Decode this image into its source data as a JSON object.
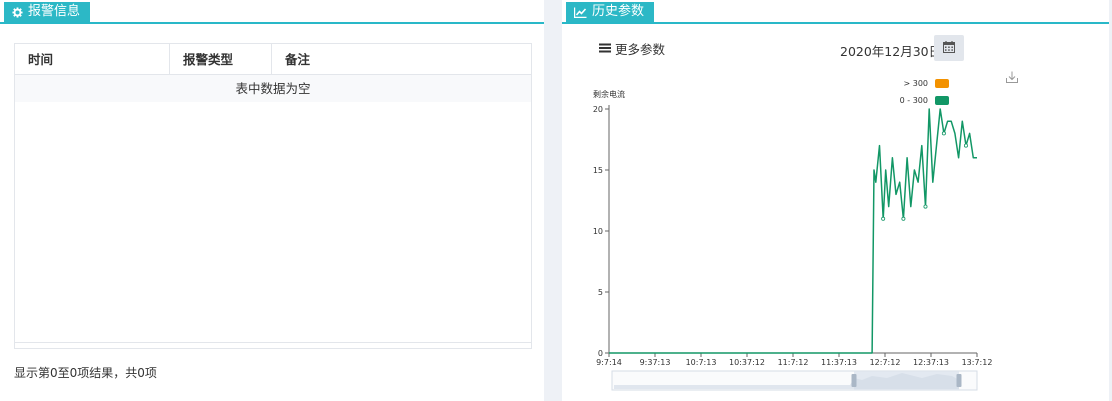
{
  "left": {
    "title": "报警信息",
    "columns": [
      "时间",
      "报警类型",
      "备注"
    ],
    "empty_text": "表中数据为空",
    "summary": "显示第0至0项结果，共0项"
  },
  "right": {
    "title": "历史参数",
    "more_params": "更多参数",
    "date": "2020年12月30日"
  },
  "chart_data": {
    "type": "line",
    "ylabel": "剩余电流",
    "ylim": [
      0,
      20
    ],
    "yticks": [
      "0",
      "5",
      "10",
      "15",
      "20"
    ],
    "xticks": [
      "9:7:14",
      "9:37:13",
      "10:7:13",
      "10:37:12",
      "11:7:12",
      "11:37:13",
      "12:7:12",
      "12:37:13",
      "13:7:12"
    ],
    "legend": [
      {
        "label": "> 300",
        "color": "#f39200"
      },
      {
        "label": "0 - 300",
        "color": "#129766"
      }
    ],
    "line_color": "#129766",
    "series": [
      {
        "x": [
          0,
          0.7,
          0.715,
          0.72,
          0.725,
          0.735,
          0.745,
          0.752,
          0.76,
          0.77,
          0.78,
          0.79,
          0.8,
          0.81,
          0.82,
          0.83,
          0.84,
          0.85,
          0.86,
          0.87,
          0.875,
          0.88,
          0.89,
          0.9,
          0.91,
          0.92,
          0.93,
          0.94,
          0.95,
          0.96,
          0.97,
          0.98,
          0.99,
          1.0
        ],
        "values": [
          0,
          0,
          0,
          15,
          14,
          17,
          11,
          15,
          12,
          16,
          13,
          14,
          11,
          16,
          12,
          15,
          14,
          17,
          12,
          20,
          17,
          14,
          17,
          20,
          18,
          19,
          19,
          18,
          16,
          19,
          17,
          18,
          16,
          16
        ]
      }
    ]
  }
}
